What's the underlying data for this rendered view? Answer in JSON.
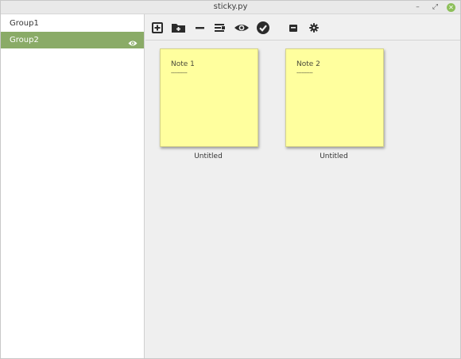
{
  "window": {
    "title": "sticky.py",
    "controls": {
      "minimize": "–",
      "maximize": "⤢",
      "close": "✕"
    }
  },
  "sidebar": {
    "groups": [
      {
        "label": "Group1",
        "selected": false,
        "visible_icon": false
      },
      {
        "label": "Group2",
        "selected": true,
        "visible_icon": true
      }
    ],
    "selected_color": "#8aab67"
  },
  "toolbar": {
    "buttons": [
      {
        "name": "new-note",
        "icon": "plus-square-icon"
      },
      {
        "name": "new-group",
        "icon": "folder-plus-icon"
      },
      {
        "name": "remove",
        "icon": "minus-icon"
      },
      {
        "name": "rename",
        "icon": "text-field-icon"
      },
      {
        "name": "show",
        "icon": "eye-icon"
      },
      {
        "name": "done",
        "icon": "check-circle-icon"
      },
      {
        "name": "backup",
        "icon": "archive-icon"
      },
      {
        "name": "settings",
        "icon": "gear-icon"
      }
    ]
  },
  "notes": [
    {
      "text": "Note 1",
      "underline": "----------",
      "caption": "Untitled",
      "color": "#ffff9e"
    },
    {
      "text": "Note 2",
      "underline": "----------",
      "caption": "Untitled",
      "color": "#ffff9e"
    }
  ]
}
